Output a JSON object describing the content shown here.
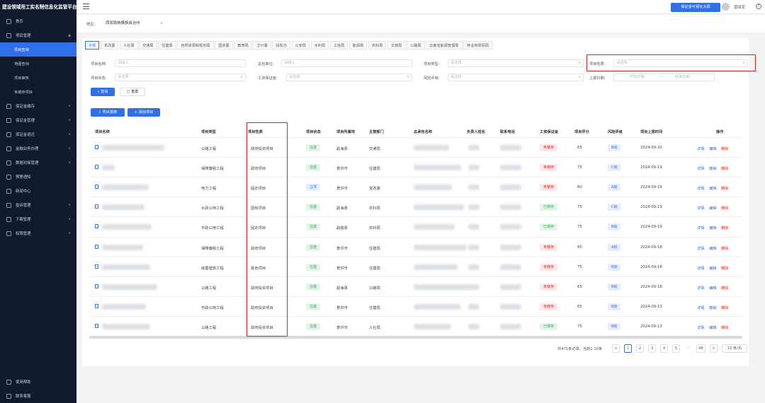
{
  "app": {
    "title": "建设领域用工实名制信息化监管平台"
  },
  "sidebar": {
    "items": [
      {
        "label": "首页"
      },
      {
        "label": "项目管理",
        "expanded": "▲"
      },
      {
        "label": "项目查询"
      },
      {
        "label": "地图查询"
      },
      {
        "label": "项目审核"
      },
      {
        "label": "未缴存项目"
      },
      {
        "label": "保证金缴存"
      },
      {
        "label": "保证金管理"
      },
      {
        "label": "保证金退还"
      },
      {
        "label": "金融业务办理"
      },
      {
        "label": "数据对接管理"
      },
      {
        "label": "预警通知"
      },
      {
        "label": "新闻中心"
      },
      {
        "label": "投诉管理"
      },
      {
        "label": "下载管理"
      },
      {
        "label": "权限管理"
      }
    ],
    "bottom": [
      {
        "label": "使用帮助"
      },
      {
        "label": "联系客服"
      }
    ]
  },
  "topbar": {
    "screen_btn": "保证金可视化大屏",
    "user": "曾晓军"
  },
  "region": {
    "label": "地区:",
    "value": "西双版纳傣族自治州"
  },
  "tabs": [
    "全部",
    "发改委",
    "人社局",
    "交通局",
    "住建局",
    "自然资源和规划局",
    "国资委",
    "教育局",
    "卫计委",
    "扶贫办",
    "公安局",
    "水利局",
    "工信局",
    "能源局",
    "农科局",
    "文旅局",
    "公路局",
    "云南省能源管理局",
    "林业和草原局"
  ],
  "filters": {
    "name_label": "项目名称:",
    "name_ph": "请输入",
    "contractor_label": "总包单位:",
    "contractor_ph": "请输入",
    "type_label": "项目类型:",
    "type_ph": "请选择",
    "nature_label": "项目性质:",
    "nature_ph": "请选择",
    "status_label": "项目状态:",
    "status_ph": "请选择",
    "deposit_label": "工资保证金:",
    "deposit_ph": "请选择",
    "risk_label": "风险评级:",
    "risk_ph": "请选择",
    "date_label": "上报日期:",
    "date_start": "开始日期",
    "date_sep": "—",
    "date_end": "结束日期",
    "search_btn": "查询",
    "reset_btn": "重置",
    "export_btn": "导出报表",
    "add_btn": "添加项目"
  },
  "table": {
    "headers": [
      "项目名称",
      "项目类型",
      "项目性质",
      "项目状态",
      "项目所属地",
      "主管部门",
      "总承包名称",
      "负责人姓名",
      "联系电话",
      "工资保证金",
      "项目评分",
      "风险评级",
      "项目上报时间",
      "操作"
    ],
    "rows": [
      {
        "type": "公路工程",
        "nature": "政府投资项目",
        "status": "在建",
        "status_c": "gr",
        "loc": "勐海县",
        "dept": "交通局",
        "deposit": "未缴存",
        "deposit_c": "rd",
        "score": "65",
        "risk": "B级",
        "time": "2024-09-20",
        "actions": [
          "详情",
          "编辑",
          "删除"
        ]
      },
      {
        "type": "保障廉租工程",
        "nature": "政府项目",
        "status": "在建",
        "status_c": "gr",
        "loc": "景洪市",
        "dept": "住建局",
        "deposit": "未缴存",
        "deposit_c": "rd",
        "score": "75",
        "risk": "C级",
        "time": "2024-09-19",
        "actions": [
          "详情",
          "撤销",
          "删除"
        ]
      },
      {
        "type": "电力工程",
        "nature": "固定项目",
        "status": "立项",
        "status_c": "bl",
        "loc": "景洪市",
        "dept": "发改委",
        "deposit": "未缴存",
        "deposit_c": "rd",
        "score": "80",
        "risk": "A级",
        "time": "2024-09-19",
        "actions": [
          "详情",
          "编辑",
          "删除"
        ]
      },
      {
        "type": "水政公用工程",
        "nature": "国有项目",
        "status": "在建",
        "status_c": "gr",
        "loc": "勐海县",
        "dept": "农科局",
        "deposit": "已缴存",
        "deposit_c": "gr",
        "score": "75",
        "risk": "C级",
        "time": "2024-09-19",
        "actions": [
          "详情",
          "编辑",
          "删除"
        ]
      },
      {
        "type": "市政公用工程",
        "nature": "固定项目",
        "status": "在建",
        "status_c": "gr",
        "loc": "勐腊县",
        "dept": "农科局",
        "deposit": "已缴存",
        "deposit_c": "gr",
        "score": "75",
        "risk": "B级",
        "time": "2024-09-19",
        "actions": [
          "详情",
          "编辑",
          "删除"
        ]
      },
      {
        "type": "保障廉租工程",
        "nature": "政府项目",
        "status": "在建",
        "status_c": "gr",
        "loc": "景洪市",
        "dept": "住建局",
        "deposit": "未缴存",
        "deposit_c": "rd",
        "score": "80",
        "risk": "A级",
        "time": "2024-09-18",
        "actions": [
          "详情",
          "编辑",
          "删除"
        ]
      },
      {
        "type": "房屋建筑工程",
        "nature": "其他项目",
        "status": "在建",
        "status_c": "gr",
        "loc": "景洪市",
        "dept": "住建局",
        "deposit": "未缴存",
        "deposit_c": "rd",
        "score": "75",
        "risk": "B级",
        "time": "2024-09-18",
        "actions": [
          "详情",
          "编辑",
          "删除"
        ]
      },
      {
        "type": "公路工程",
        "nature": "政府投资项目",
        "status": "在建",
        "status_c": "gr",
        "loc": "勐海县",
        "dept": "公路局",
        "deposit": "未缴存",
        "deposit_c": "rd",
        "score": "65",
        "risk": "B级",
        "time": "2024-09-18",
        "actions": [
          "详情",
          "编辑",
          "删除"
        ]
      },
      {
        "type": "市政公用工程",
        "nature": "政府投资项目",
        "status": "在建",
        "status_c": "gr",
        "loc": "景洪市",
        "dept": "住建局",
        "deposit": "未缴存",
        "deposit_c": "rd",
        "score": "65",
        "risk": "B级",
        "time": "2024-09-13",
        "actions": [
          "详情",
          "撤销",
          "删除"
        ]
      },
      {
        "type": "公路工程",
        "nature": "政府投资项目",
        "status": "在建",
        "status_c": "gr",
        "loc": "景洪市",
        "dept": "人社局",
        "deposit": "已缴存",
        "deposit_c": "gr",
        "score": "75",
        "risk": "B级",
        "time": "2024-09-13",
        "actions": [
          "详情",
          "编辑",
          "删除"
        ]
      }
    ]
  },
  "pagination": {
    "total": "共471条记录，当前1-10条",
    "prev": "<",
    "pages": [
      "1",
      "2",
      "3",
      "4",
      "5",
      "···",
      "48"
    ],
    "next": ">",
    "size": "10 条/页"
  },
  "colors": {
    "accent": "#2f6fea",
    "highlight": "#e0211f",
    "sidebar": "#0f1a2c"
  }
}
